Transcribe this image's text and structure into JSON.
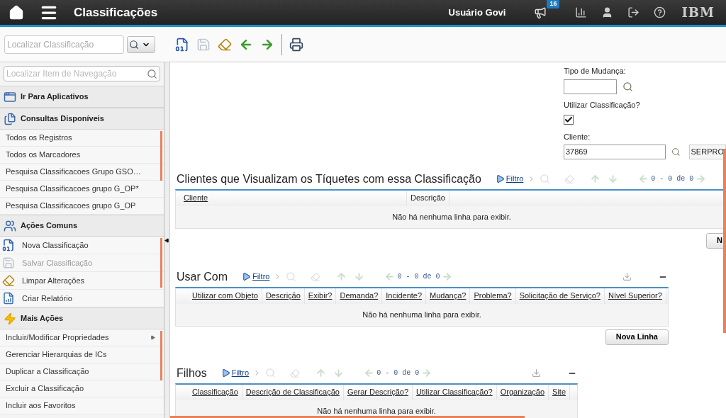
{
  "header": {
    "title": "Classificações",
    "user": "Usuário Govi",
    "badge": "16",
    "logo": "IBM"
  },
  "toolbar": {
    "search_placeholder": "Localizar Classificação",
    "tools": [
      {
        "kind": "new",
        "disabled": false
      },
      {
        "kind": "save",
        "disabled": true
      },
      {
        "kind": "clear",
        "disabled": false
      },
      {
        "kind": "prev",
        "disabled": false
      },
      {
        "kind": "next",
        "disabled": false
      },
      {
        "kind": "print",
        "disabled": false
      }
    ]
  },
  "sidebar": {
    "search_placeholder": "Localizar Item de Navegação",
    "sections": [
      {
        "title": "Ir Para Aplicativos",
        "kind": "apps"
      },
      {
        "title": "Consultas Disponíveis",
        "kind": "queries",
        "items": [
          {
            "label": "Todos os Registros"
          },
          {
            "label": "Todos os Marcadores"
          },
          {
            "label": "Pesquisa Classificacoes Grupo GSO…"
          },
          {
            "label": "Pesquisa Classificacoes grupo G_OP*"
          },
          {
            "label": "Pesquisa Classificacoes grupo G_OP"
          }
        ]
      },
      {
        "title": "Ações Comuns",
        "kind": "actions",
        "items": [
          {
            "label": "Nova Classificação",
            "kind": "new",
            "disabled": false
          },
          {
            "label": "Salvar Classificação",
            "kind": "save",
            "disabled": true
          },
          {
            "label": "Limpar Alterações",
            "kind": "clear",
            "disabled": false
          },
          {
            "label": "Criar Relatório",
            "kind": "report",
            "disabled": false
          }
        ]
      },
      {
        "title": "Mais Ações",
        "kind": "more",
        "items": [
          {
            "label": "Incluir/Modificar Propriedades",
            "submenu": true
          },
          {
            "label": "Gerenciar Hierarquias de ICs",
            "submenu": false
          },
          {
            "label": "Duplicar a Classificação",
            "submenu": false
          },
          {
            "label": "Excluir a Classificação",
            "submenu": false
          },
          {
            "label": "Incluir aos Favoritos",
            "submenu": false
          }
        ]
      }
    ]
  },
  "form": {
    "change_type": {
      "label": "Tipo de Mudança:"
    },
    "use_classification": {
      "label": "Utilizar Classificação?",
      "checked": true
    },
    "client": {
      "label": "Cliente:",
      "value": "37869",
      "description": "SERPRO"
    }
  },
  "tables": [
    {
      "title": "Clientes que Visualizam os Tíquetes com essa Classificação",
      "filter": "Filtro",
      "pager": "0 - 0 de 0",
      "collapsible": false,
      "columns": [
        {
          "label": "Cliente",
          "sortable": true
        },
        {
          "label": "Descrição",
          "sortable": false
        }
      ],
      "empty": "Não há nenhuma linha para exibir.",
      "button": "N"
    },
    {
      "title": "Usar Com",
      "filter": "Filtro",
      "pager": "0 - 0 de 0",
      "collapsible": true,
      "columns": [
        {
          "label": "Utilizar com Objeto",
          "sortable": true
        },
        {
          "label": "Descrição",
          "sortable": true
        },
        {
          "label": "Exibir?",
          "sortable": true
        },
        {
          "label": "Demanda?",
          "sortable": true
        },
        {
          "label": "Incidente?",
          "sortable": true
        },
        {
          "label": "Mudança?",
          "sortable": true
        },
        {
          "label": "Problema?",
          "sortable": true
        },
        {
          "label": "Solicitação de Serviço?",
          "sortable": true
        },
        {
          "label": "Nível Superior?",
          "sortable": true
        }
      ],
      "empty": "Não há nenhuma linha para exibir.",
      "button": "Nova Linha"
    },
    {
      "title": "Filhos",
      "filter": "Filtro",
      "pager": "0 - 0 de 0",
      "collapsible": true,
      "columns": [
        {
          "label": "Classificação",
          "sortable": true
        },
        {
          "label": "Descrição de Classificação",
          "sortable": true
        },
        {
          "label": "Gerar Descrição?",
          "sortable": true
        },
        {
          "label": "Utilizar Classificação?",
          "sortable": true
        },
        {
          "label": "Organização",
          "sortable": true
        },
        {
          "label": "Site",
          "sortable": true
        }
      ],
      "empty": "Não há nenhuma linha para exibir."
    }
  ]
}
